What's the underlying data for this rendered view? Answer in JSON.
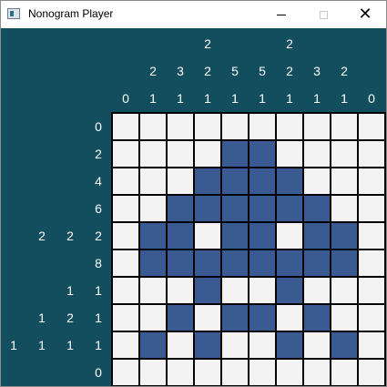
{
  "window": {
    "title": "Nonogram Player"
  },
  "titlebar_icons": {
    "app": "nonogram-app-icon",
    "minimize": "minimize-icon",
    "maximize": "maximize-icon",
    "close": "close-icon",
    "close_glyph": "✕"
  },
  "colors": {
    "board_bg": "#134e5e",
    "filled": "#3a5a92",
    "empty": "#f3f3f3",
    "grid_lines": "#000000",
    "clue_text": "#ffffff"
  },
  "puzzle": {
    "rows": 10,
    "cols": 10,
    "column_clues": [
      [
        "0"
      ],
      [
        "2",
        "1"
      ],
      [
        "3",
        "1"
      ],
      [
        "2",
        "2",
        "1"
      ],
      [
        "5",
        "1"
      ],
      [
        "5",
        "1"
      ],
      [
        "2",
        "2",
        "1"
      ],
      [
        "3",
        "1"
      ],
      [
        "2",
        "1"
      ],
      [
        "0"
      ]
    ],
    "row_clues": [
      [
        "0"
      ],
      [
        "2"
      ],
      [
        "4"
      ],
      [
        "6"
      ],
      [
        "2",
        "2",
        "2"
      ],
      [
        "8"
      ],
      [
        "1",
        "1"
      ],
      [
        "1",
        "2",
        "1"
      ],
      [
        "1",
        "1",
        "1",
        "1"
      ],
      [
        "0"
      ]
    ],
    "grid": [
      [
        0,
        0,
        0,
        0,
        0,
        0,
        0,
        0,
        0,
        0
      ],
      [
        0,
        0,
        0,
        0,
        1,
        1,
        0,
        0,
        0,
        0
      ],
      [
        0,
        0,
        0,
        1,
        1,
        1,
        1,
        0,
        0,
        0
      ],
      [
        0,
        0,
        1,
        1,
        1,
        1,
        1,
        1,
        0,
        0
      ],
      [
        0,
        1,
        1,
        0,
        1,
        1,
        0,
        1,
        1,
        0
      ],
      [
        0,
        1,
        1,
        1,
        1,
        1,
        1,
        1,
        1,
        0
      ],
      [
        0,
        0,
        0,
        1,
        0,
        0,
        1,
        0,
        0,
        0
      ],
      [
        0,
        0,
        1,
        0,
        1,
        1,
        0,
        1,
        0,
        0
      ],
      [
        0,
        1,
        0,
        1,
        0,
        0,
        1,
        0,
        1,
        0
      ],
      [
        0,
        0,
        0,
        0,
        0,
        0,
        0,
        0,
        0,
        0
      ]
    ]
  }
}
